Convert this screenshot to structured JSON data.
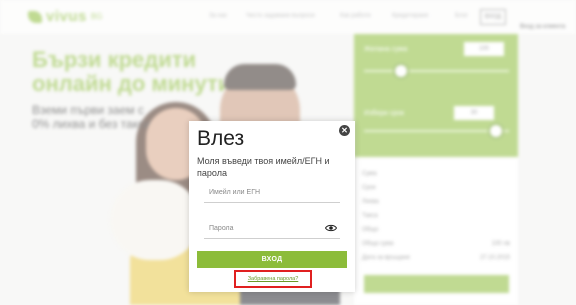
{
  "header": {
    "logo_text": "vivus",
    "logo_sub": "BG",
    "nav": [
      "За нас",
      "Често задавани въпроси",
      "Как работи",
      "Кредитиране",
      "Блог"
    ],
    "login_label": "ВХОД",
    "callout_text": "Вход за клиента"
  },
  "hero": {
    "title_line1": "Бързи кредити",
    "title_line2": "онлайн до минути",
    "sub_line1": "Вземи първи заем с",
    "sub_line2": "0% лихва и без такси"
  },
  "calculator": {
    "amount_label": "Желана сума",
    "amount_value": "100",
    "term_label": "Избери срок",
    "term_value": "30",
    "amount_level": 0.25,
    "term_level": 0.9
  },
  "summary": {
    "rows": [
      "Сума",
      "Срок",
      "Лихва",
      "Такса",
      "Общо"
    ],
    "total_label": "Обща сума",
    "total_value": "100 лв",
    "date_label": "Дата за връщане",
    "date_value": "27.10.2015"
  },
  "modal": {
    "title": "Влез",
    "subtitle": "Моля въведи твоя имейл/ЕГН и парола",
    "email_placeholder": "Имейл или ЕГН",
    "password_placeholder": "Парола",
    "login_button": "ВХОД",
    "forgot_link": "Забравена парола?",
    "close_icon": "close-icon",
    "eye_icon": "eye-icon"
  },
  "colors": {
    "brand_green": "#8cbc3a",
    "highlight_red": "#e02020"
  }
}
